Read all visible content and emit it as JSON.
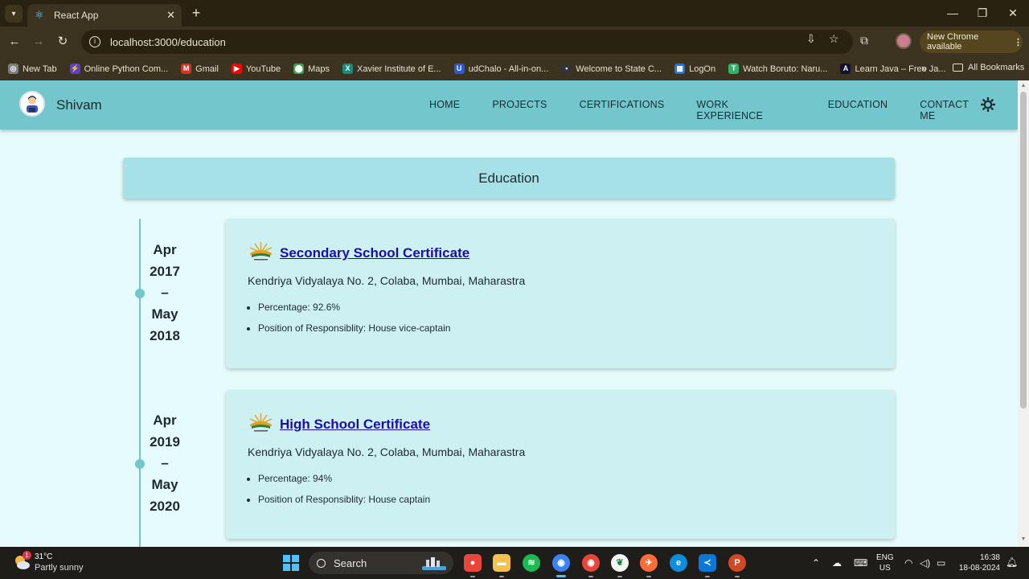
{
  "browser": {
    "tab_title": "React App",
    "url": "localhost:3000/education",
    "update_label": "New Chrome available",
    "bookmarks": [
      {
        "label": "New Tab",
        "color": "#7d7d7d",
        "glyph": "◎"
      },
      {
        "label": "Online Python Com...",
        "color": "#5b3fd1",
        "glyph": "⚡"
      },
      {
        "label": "Gmail",
        "color": "#d93025",
        "glyph": "M"
      },
      {
        "label": "YouTube",
        "color": "#ff0000",
        "glyph": "▶"
      },
      {
        "label": "Maps",
        "color": "#34a853",
        "glyph": "⬤"
      },
      {
        "label": "Xavier Institute of E...",
        "color": "#1b8a7a",
        "glyph": "X"
      },
      {
        "label": "udChalo - All-in-on...",
        "color": "#2b58d6",
        "glyph": "U"
      },
      {
        "label": "Welcome to State C...",
        "color": "#333333",
        "glyph": "•"
      },
      {
        "label": "LogOn",
        "color": "#1b73e8",
        "glyph": "▦"
      },
      {
        "label": "Watch Boruto: Naru...",
        "color": "#2fb36a",
        "glyph": "T"
      },
      {
        "label": "Learn Java – Free Ja...",
        "color": "#111133",
        "glyph": "A"
      }
    ],
    "all_bookmarks_label": "All Bookmarks"
  },
  "navbar": {
    "brand": "Shivam",
    "links": [
      "HOME",
      "PROJECTS",
      "CERTIFICATIONS",
      "WORK EXPERIENCE",
      "EDUCATION",
      "CONTACT ME"
    ]
  },
  "section": {
    "title": "Education"
  },
  "education": [
    {
      "date_lines": [
        "Apr",
        "2017",
        "–",
        "May",
        "2018"
      ],
      "title": "Secondary School Certificate",
      "school": "Kendriya Vidyalaya No. 2, Colaba, Mumbai, Maharastra",
      "points": [
        "Percentage: 92.6%",
        "Position of Responsiblity: House vice-captain"
      ]
    },
    {
      "date_lines": [
        "Apr",
        "2019",
        "–",
        "May",
        "2020"
      ],
      "title": "High School Certificate",
      "school": "Kendriya Vidyalaya No. 2, Colaba, Mumbai, Maharastra",
      "points": [
        "Percentage: 94%",
        "Position of Responsiblity: House captain"
      ]
    }
  ],
  "taskbar": {
    "weather_temp": "31°C",
    "weather_desc": "Partly sunny",
    "weather_badge": "1",
    "search_label": "Search",
    "lang_line1": "ENG",
    "lang_line2": "US",
    "time": "16:38",
    "date": "18-08-2024"
  },
  "colors": {
    "navbar_bg": "#72c6cc",
    "page_bg": "#e6fbfb",
    "card_bg": "#cdf0f3",
    "header_bg": "#a6e1e8",
    "link": "#1a0dab"
  }
}
